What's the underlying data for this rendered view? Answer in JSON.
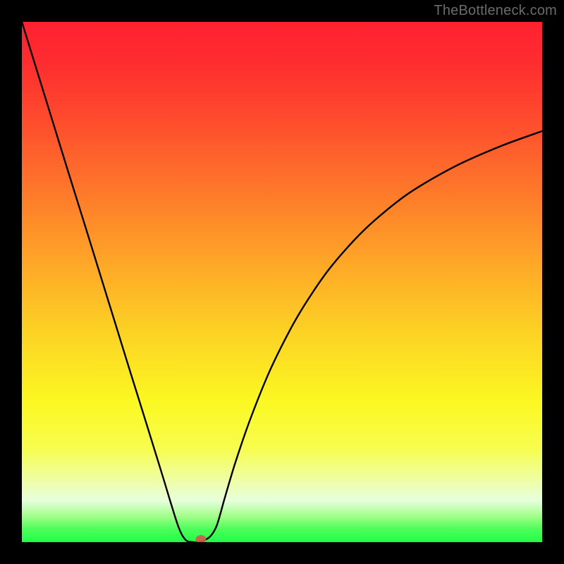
{
  "watermark": "TheBottleneck.com",
  "chart_data": {
    "type": "line",
    "title": "",
    "xlabel": "",
    "ylabel": "",
    "xlim": [
      0,
      100
    ],
    "ylim": [
      0,
      100
    ],
    "grid": false,
    "legend": false,
    "series": [
      {
        "name": "bottleneck-curve",
        "x": [
          0,
          3,
          6,
          9,
          12,
          15,
          18,
          21,
          24,
          27,
          30,
          31.5,
          33,
          34,
          35,
          36.3,
          37.5,
          39,
          41,
          44,
          48,
          53,
          59,
          66,
          74,
          83,
          92,
          100
        ],
        "y": [
          100,
          90.3,
          80.6,
          70.9,
          61.3,
          51.6,
          41.9,
          32.2,
          22.6,
          12.9,
          3.2,
          0.4,
          0,
          0,
          0.3,
          1.2,
          3.3,
          8.5,
          15.2,
          23.9,
          33.7,
          43.4,
          52.4,
          60.2,
          66.8,
          72.1,
          76.1,
          79.0
        ]
      }
    ],
    "marker": {
      "x": 34.4,
      "y": 0.5,
      "color": "#d45a4d"
    },
    "background_gradient": {
      "stops": [
        {
          "pos": 0,
          "color": "#fe2130"
        },
        {
          "pos": 50,
          "color": "#fea628"
        },
        {
          "pos": 75,
          "color": "#fbf822"
        },
        {
          "pos": 100,
          "color": "#20fd47"
        }
      ],
      "note": "y=100 maps to top (red), y=0 maps to bottom (green)"
    }
  }
}
